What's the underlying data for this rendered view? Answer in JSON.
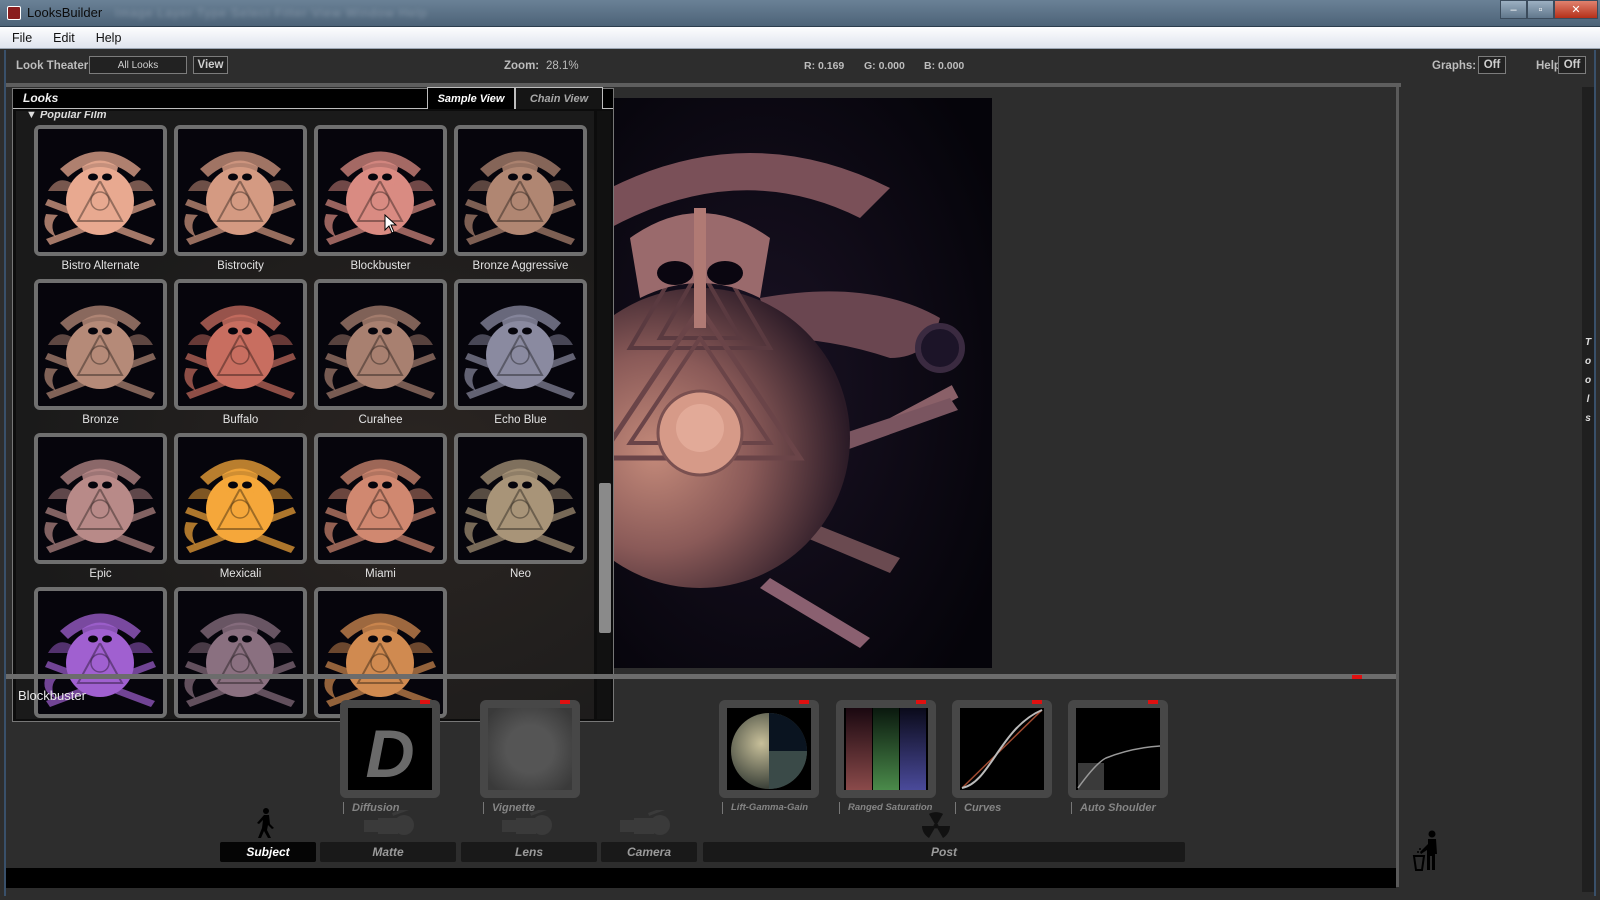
{
  "window": {
    "title": "LooksBuilder",
    "blurred_menu": "Image  Layer  Type  Select  Filter  View  Window  Help",
    "controls": {
      "minimize": "–",
      "maximize": "▫",
      "close": "✕"
    }
  },
  "menu": [
    "File",
    "Edit",
    "Help"
  ],
  "toolbar": {
    "look_theater_label": "Look Theater:",
    "look_theater_value": "All Looks",
    "view_button": "View",
    "zoom_label": "Zoom:",
    "zoom_value": "28.1%",
    "r": "R: 0.169",
    "g": "G: 0.000",
    "b": "B: 0.000",
    "graphs_label": "Graphs:",
    "graphs_value": "Off",
    "help_label": "Help:",
    "help_value": "Off"
  },
  "looks_panel": {
    "title": "Looks",
    "tabs": [
      {
        "label": "Sample View",
        "active": true
      },
      {
        "label": "Chain View",
        "active": false
      }
    ],
    "category": "Popular Film",
    "items": [
      {
        "label": "Bistro Alternate",
        "tint": "#e8a990"
      },
      {
        "label": "Bistrocity",
        "tint": "#d49a82"
      },
      {
        "label": "Blockbuster",
        "tint": "#d98b82"
      },
      {
        "label": "Bronze Aggressive",
        "tint": "#b08672"
      },
      {
        "label": "Bronze",
        "tint": "#b58a78"
      },
      {
        "label": "Buffalo",
        "tint": "#c86e60"
      },
      {
        "label": "Curahee",
        "tint": "#a88070"
      },
      {
        "label": "Echo Blue",
        "tint": "#8a8aa0"
      },
      {
        "label": "Epic",
        "tint": "#b88a88"
      },
      {
        "label": "Mexicali",
        "tint": "#f5a73a"
      },
      {
        "label": "Miami",
        "tint": "#d08870"
      },
      {
        "label": "Neo",
        "tint": "#a89478"
      },
      {
        "label": "",
        "tint": "#a060d0"
      },
      {
        "label": "",
        "tint": "#8a7080"
      },
      {
        "label": "",
        "tint": "#d08a50"
      }
    ]
  },
  "chain": {
    "look_name": "Blockbuster",
    "nodes": [
      {
        "label": "Diffusion",
        "glyph": "D"
      },
      {
        "label": "Vignette"
      },
      {
        "label": "Lift-Gamma-Gain"
      },
      {
        "label": "Ranged Saturation"
      },
      {
        "label": "Curves"
      },
      {
        "label": "Auto Shoulder"
      }
    ],
    "categories": [
      {
        "label": "Subject",
        "icon": "walking-person-icon",
        "active": true
      },
      {
        "label": "Matte",
        "icon": "movie-camera-icon",
        "active": false
      },
      {
        "label": "Lens",
        "icon": "movie-camera-icon",
        "active": false
      },
      {
        "label": "Camera",
        "icon": "movie-camera-icon",
        "active": false
      },
      {
        "label": "Post",
        "icon": "radiation-icon",
        "active": false
      }
    ]
  },
  "tools_strip": [
    "T",
    "o",
    "o",
    "l",
    "s"
  ]
}
